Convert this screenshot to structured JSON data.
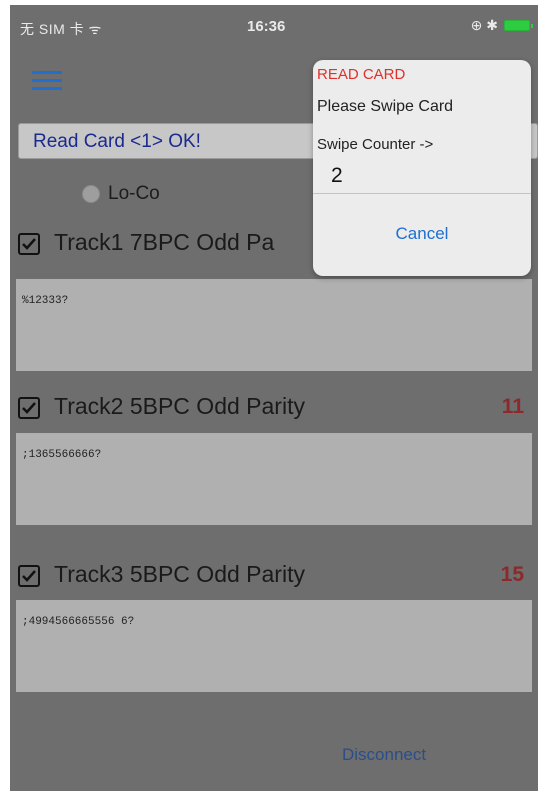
{
  "status_bar": {
    "carrier": "无 SIM 卡 ᯤ",
    "time": "16:36",
    "right_icons": "⊕ ✱"
  },
  "result_text": "Read Card <1> OK!",
  "mode": {
    "label": "Lo-Co"
  },
  "tracks": [
    {
      "title": "Track1 7BPC Odd Pa",
      "count": "",
      "data": "%12333?"
    },
    {
      "title": "Track2 5BPC Odd Parity",
      "count": "11",
      "data": ";1365566666?"
    },
    {
      "title": "Track3 5BPC Odd Parity",
      "count": "15",
      "data": ";4994566665556 6?"
    }
  ],
  "bottom": {
    "left_label": "",
    "disconnect_label": "Disconnect"
  },
  "alert": {
    "title": "READ CARD",
    "message": "Please Swipe Card",
    "counter_label": "Swipe Counter ->",
    "counter_value": "2",
    "cancel_label": "Cancel"
  },
  "colors": {
    "accent": "#1d6fd0",
    "alert_title": "#e0302b",
    "count_red": "#8b2a2a"
  }
}
